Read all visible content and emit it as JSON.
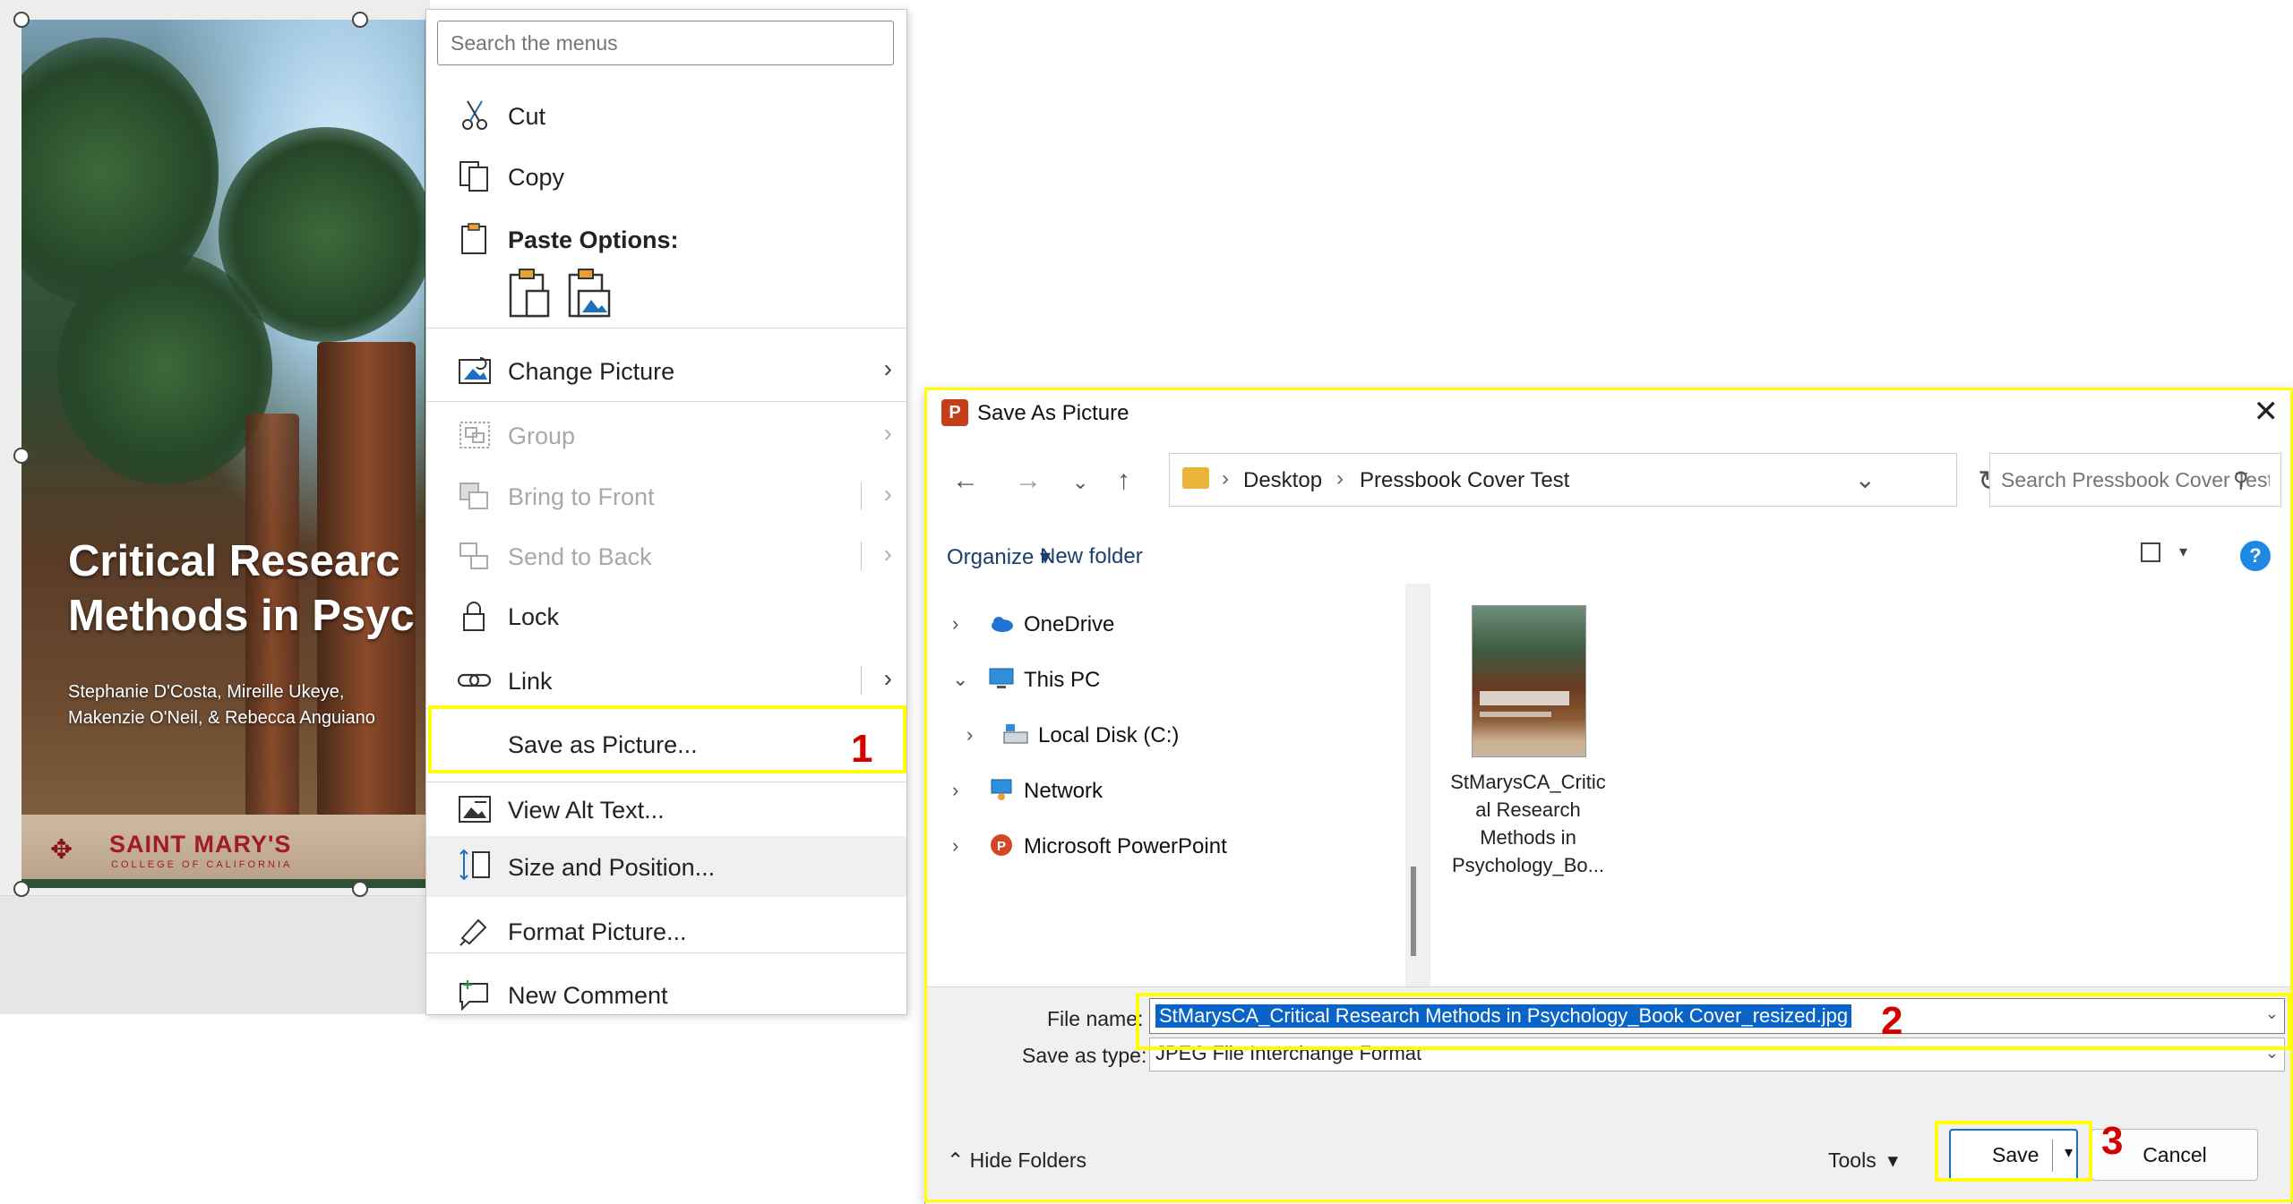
{
  "cover": {
    "title_line1": "Critical Researc",
    "title_line2": "Methods in Psyc",
    "authors_line1": "Stephanie D'Costa, Mireille Ukeye,",
    "authors_line2": "Makenzie O'Neil, & Rebecca Anguiano",
    "logo_name": "SAINT MARY'S",
    "logo_sub": "COLLEGE OF CALIFORNIA"
  },
  "menu": {
    "search_placeholder": "Search the menus",
    "items": [
      {
        "label": "Cut",
        "icon": "scissors-icon",
        "enabled": true
      },
      {
        "label": "Copy",
        "icon": "copy-icon",
        "enabled": true
      },
      {
        "label": "Paste Options:",
        "icon": "clipboard-icon",
        "enabled": true
      },
      {
        "label": "Change Picture",
        "icon": "change-picture-icon",
        "enabled": true,
        "submenu": true
      },
      {
        "label": "Group",
        "icon": "group-icon",
        "enabled": false,
        "submenu": true
      },
      {
        "label": "Bring to Front",
        "icon": "bring-to-front-icon",
        "enabled": false,
        "submenu": true
      },
      {
        "label": "Send to Back",
        "icon": "send-to-back-icon",
        "enabled": false,
        "submenu": true
      },
      {
        "label": "Lock",
        "icon": "lock-icon",
        "enabled": true
      },
      {
        "label": "Link",
        "icon": "link-icon",
        "enabled": true,
        "submenu": true
      },
      {
        "label": "Save as Picture...",
        "icon": "",
        "enabled": true
      },
      {
        "label": "View Alt Text...",
        "icon": "alt-text-icon",
        "enabled": true
      },
      {
        "label": "Size and Position...",
        "icon": "size-position-icon",
        "enabled": true
      },
      {
        "label": "Format Picture...",
        "icon": "format-picture-icon",
        "enabled": true
      },
      {
        "label": "New Comment",
        "icon": "new-comment-icon",
        "enabled": true
      }
    ]
  },
  "annotations": {
    "step1": "1",
    "step2": "2",
    "step3": "3",
    "highlight_color": "#ffff00",
    "number_color": "#d40000"
  },
  "dialog": {
    "title": "Save As Picture",
    "breadcrumb": [
      "Desktop",
      "Pressbook Cover Test"
    ],
    "search_placeholder": "Search Pressbook Cover Test",
    "toolbar": {
      "organize": "Organize",
      "new_folder": "New folder"
    },
    "tree": [
      {
        "label": "OneDrive",
        "icon": "onedrive-icon",
        "expanded": false
      },
      {
        "label": "This PC",
        "icon": "pc-icon",
        "expanded": true
      },
      {
        "label": "Local Disk (C:)",
        "icon": "disk-icon",
        "expanded": false
      },
      {
        "label": "Network",
        "icon": "network-icon",
        "expanded": false
      },
      {
        "label": "Microsoft PowerPoint",
        "icon": "powerpoint-icon",
        "expanded": false
      }
    ],
    "file": {
      "label_lines": [
        "StMarysCA_Critic",
        "al Research",
        "Methods in",
        "Psychology_Bo..."
      ]
    },
    "file_name_label": "File name:",
    "file_name_value": "StMarysCA_Critical Research Methods in Psychology_Book Cover_resized.jpg",
    "save_type_label": "Save as type:",
    "save_type_value": "JPEG File Interchange Format",
    "hide_folders": "Hide Folders",
    "tools": "Tools",
    "save": "Save",
    "cancel": "Cancel"
  }
}
